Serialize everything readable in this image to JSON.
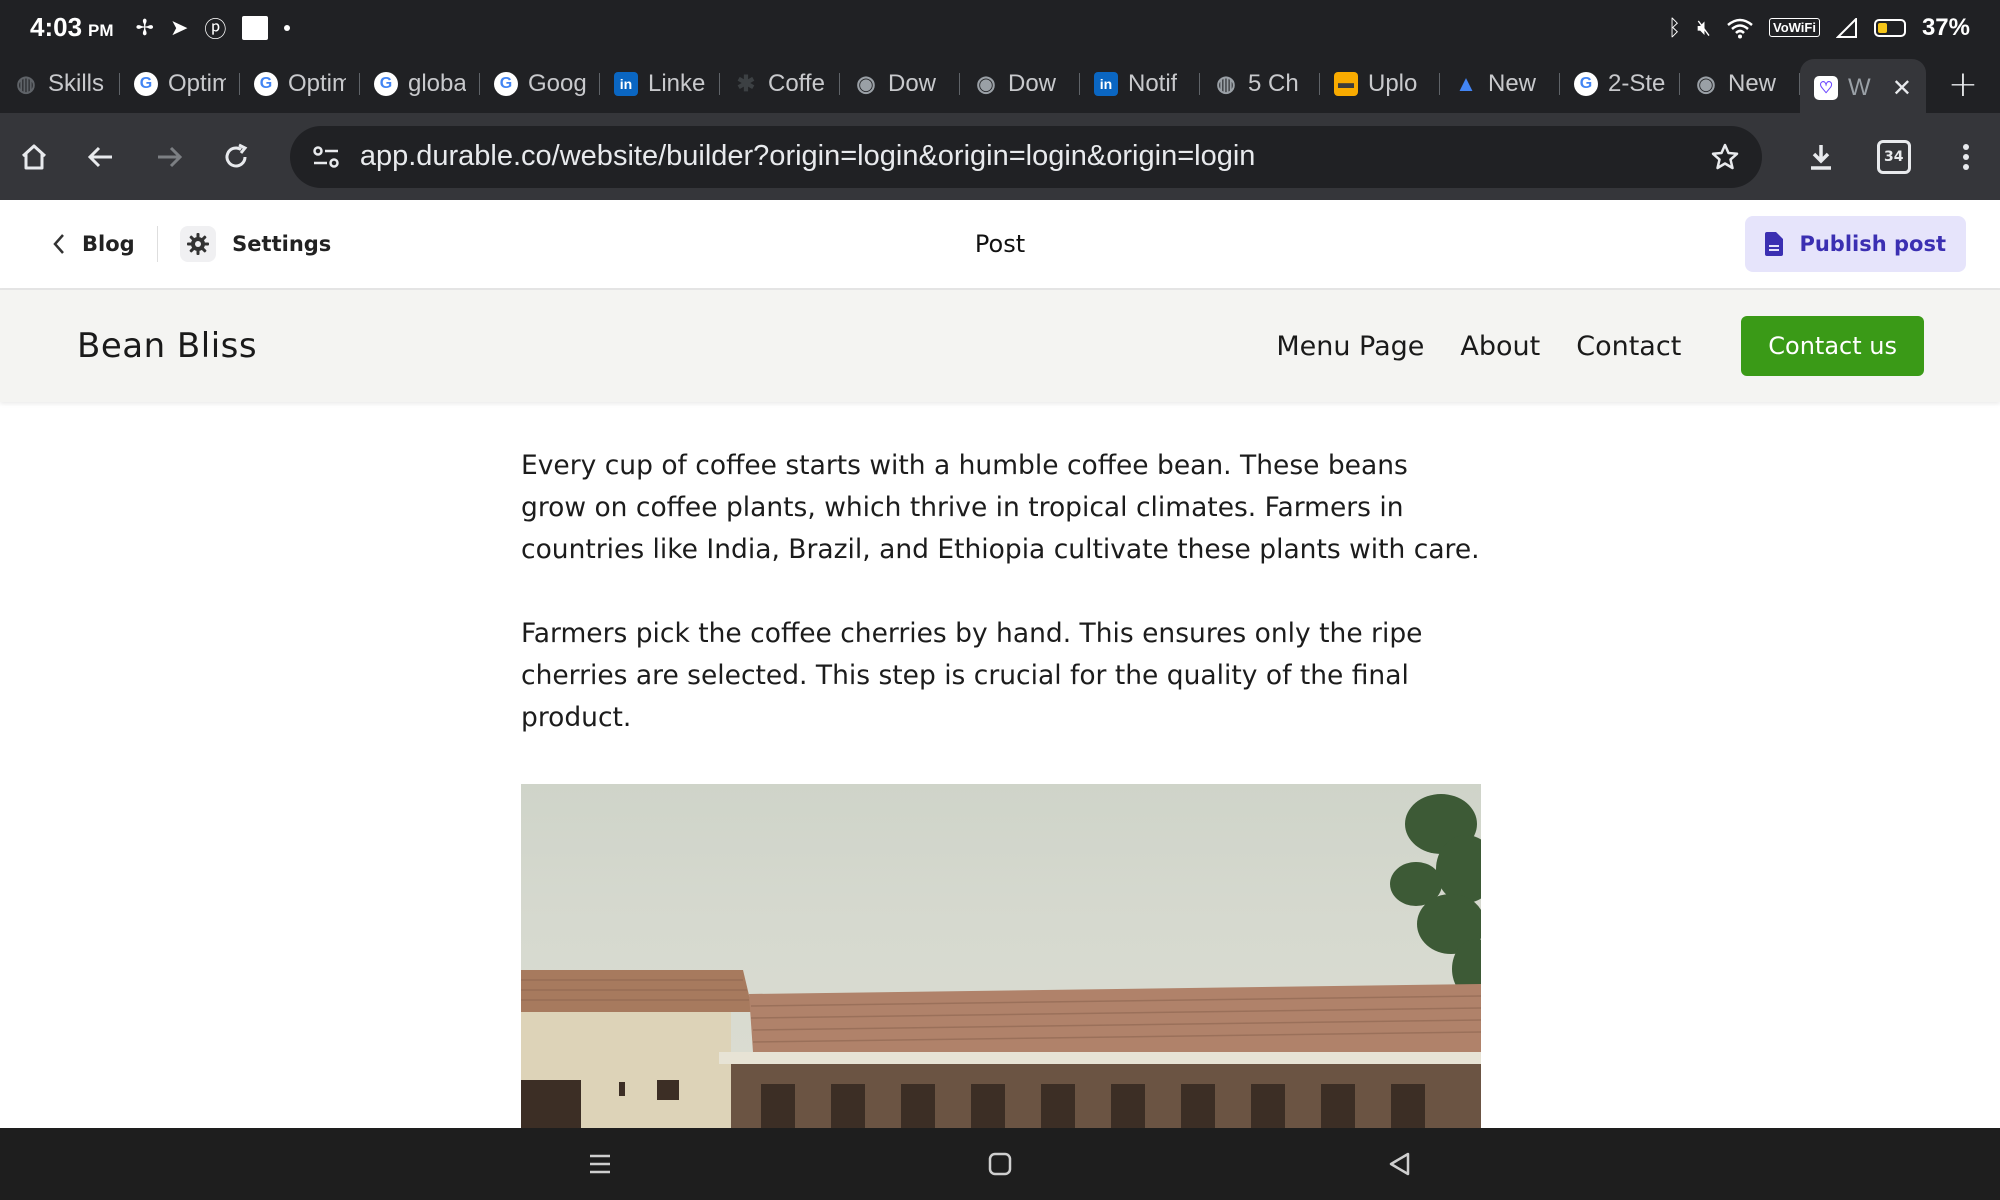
{
  "status_bar": {
    "time": "4:03",
    "ampm": "PM",
    "battery_percent": "37%",
    "battery_level": 0.37,
    "vowifi": "VoWiFi"
  },
  "tabs": [
    {
      "label": "Skills",
      "favicon": "globe-icon",
      "color": "#5f6368"
    },
    {
      "label": "Optim",
      "favicon": "google-icon",
      "color": "#4285f4"
    },
    {
      "label": "Optim",
      "favicon": "google-icon",
      "color": "#4285f4"
    },
    {
      "label": "globa",
      "favicon": "google-icon",
      "color": "#4285f4"
    },
    {
      "label": "Goog",
      "favicon": "google-icon",
      "color": "#4285f4"
    },
    {
      "label": "Linke",
      "favicon": "linkedin-icon",
      "color": "#0a66c2"
    },
    {
      "label": "Coffe",
      "favicon": "coffee-icon",
      "color": "#3c4043"
    },
    {
      "label": "Dow",
      "favicon": "chrome-icon",
      "color": "#9aa0a6"
    },
    {
      "label": "Dow",
      "favicon": "chrome-icon",
      "color": "#9aa0a6"
    },
    {
      "label": "Notif",
      "favicon": "linkedin-icon",
      "color": "#0a66c2"
    },
    {
      "label": "5 Ch",
      "favicon": "globe-icon",
      "color": "#9aa0a6"
    },
    {
      "label": "Uplo",
      "favicon": "upload-icon",
      "color": "#f9ab00"
    },
    {
      "label": "New",
      "favicon": "ads-icon",
      "color": "#4285f4"
    },
    {
      "label": "2-Ste",
      "favicon": "google-icon",
      "color": "#4285f4"
    },
    {
      "label": "New",
      "favicon": "chrome-icon",
      "color": "#9aa0a6"
    }
  ],
  "active_tab": {
    "label": "W",
    "favicon": "durable-icon",
    "color": "#6d4aff"
  },
  "toolbar": {
    "url": "app.durable.co/website/builder?origin=login&origin=login&origin=login",
    "tab_count": "34"
  },
  "builder": {
    "back_label": "Blog",
    "settings_label": "Settings",
    "title": "Post",
    "publish_label": "Publish post"
  },
  "site": {
    "brand": "Bean Bliss",
    "nav": [
      "Menu Page",
      "About",
      "Contact"
    ],
    "cta": "Contact us",
    "accent": "#3a9a17"
  },
  "article": {
    "paragraphs": [
      "Every cup of coffee starts with a humble coffee bean. These beans grow on coffee plants, which thrive in tropical climates. Farmers in countries like India, Brazil, and Ethiopia cultivate these plants with care.",
      "Farmers pick the coffee cherries by hand. This ensures only the ripe cherries are selected. This step is crucial for the quality of the final product."
    ]
  }
}
